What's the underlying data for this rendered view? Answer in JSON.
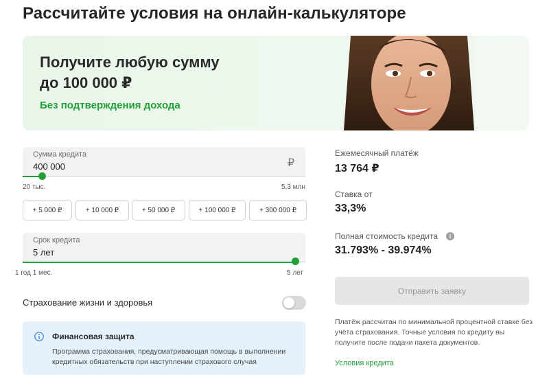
{
  "page": {
    "title": "Рассчитайте условия на онлайн-калькуляторе"
  },
  "banner": {
    "heading_line1": "Получите любую сумму",
    "heading_line2": "до 100 000 ₽",
    "subheading": "Без подтверждения дохода"
  },
  "amount": {
    "label": "Сумма кредита",
    "value": "400 000",
    "currency": "₽",
    "min_label": "20 тыс.",
    "max_label": "5,3 млн",
    "slider_fraction": 0.07
  },
  "chips": [
    "+ 5 000 ₽",
    "+ 10 000 ₽",
    "+ 50 000 ₽",
    "+ 100 000 ₽",
    "+ 300 000 ₽"
  ],
  "term": {
    "label": "Срок кредита",
    "value": "5 лет",
    "min_label": "1 год 1 мес.",
    "max_label": "5 лет",
    "slider_fraction": 1.0
  },
  "insurance": {
    "label": "Страхование жизни и здоровья",
    "enabled": false
  },
  "info": {
    "title": "Финансовая защита",
    "text": "Программа страхования, предусматривающая помощь в выполнении кредитных обязательств при наступлении страхового случая"
  },
  "results": {
    "monthly_label": "Ежемесячный платёж",
    "monthly_value": "13 764 ₽",
    "rate_label": "Ставка от",
    "rate_value": "33,3%",
    "full_cost_label": "Полная стоимость кредита",
    "full_cost_value": "31.793% - 39.974%"
  },
  "submit_label": "Отправить заявку",
  "note": "Платёж рассчитан по минимальной процентной ставке без учёта страхования. Точные условия по кредиту вы получите после подачи пакета документов.",
  "terms_link": "Условия кредита",
  "colors": {
    "accent": "#21a038",
    "info_bg": "#e6f2fb",
    "banner_bg": "#eaf6ea"
  }
}
